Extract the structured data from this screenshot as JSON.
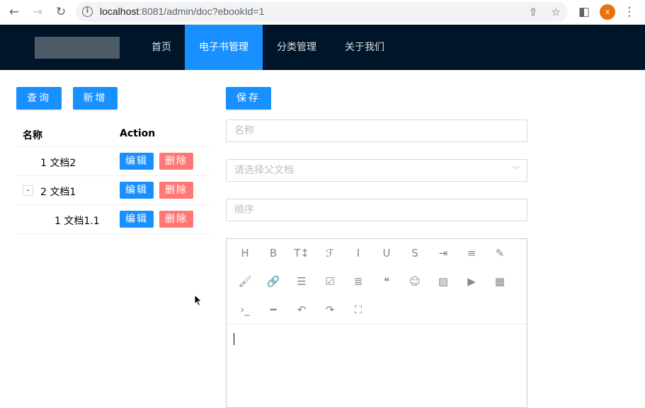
{
  "browser": {
    "url_host": "localhost",
    "url_rest": ":8081/admin/doc?ebookId=1",
    "profile_initial": "x"
  },
  "header": {
    "menu": [
      {
        "label": "首页",
        "active": false
      },
      {
        "label": "电子书管理",
        "active": true
      },
      {
        "label": "分类管理",
        "active": false
      },
      {
        "label": "关于我们",
        "active": false
      }
    ]
  },
  "left": {
    "query_label": "查询",
    "add_label": "新增",
    "columns": [
      "名称",
      "Action"
    ],
    "rows": [
      {
        "name": "1 文档2",
        "edit": "编辑",
        "delete": "删除"
      },
      {
        "expander": "-",
        "name": "2 文档1",
        "edit": "编辑",
        "delete": "删除"
      },
      {
        "name": "1 文档1.1",
        "edit": "编辑",
        "delete": "删除"
      }
    ]
  },
  "form": {
    "save_label": "保存",
    "name_placeholder": "名称",
    "parent_placeholder": "请选择父文档",
    "sort_placeholder": "顺序"
  },
  "editor": {
    "toolbar_icons": [
      {
        "name": "heading-icon",
        "glyph": "H"
      },
      {
        "name": "bold-icon",
        "glyph": "B"
      },
      {
        "name": "font-size-icon",
        "glyph": "T↕"
      },
      {
        "name": "font-family-icon",
        "glyph": "ℱ"
      },
      {
        "name": "italic-icon",
        "glyph": "I"
      },
      {
        "name": "underline-icon",
        "glyph": "U"
      },
      {
        "name": "strikethrough-icon",
        "glyph": "S"
      },
      {
        "name": "indent-icon",
        "glyph": "⇥"
      },
      {
        "name": "line-height-icon",
        "glyph": "≡"
      },
      {
        "name": "font-color-icon",
        "glyph": "✎"
      },
      {
        "name": "background-color-icon",
        "glyph": "🖌"
      },
      {
        "name": "link-icon",
        "glyph": "🔗"
      },
      {
        "name": "list-icon",
        "glyph": "☰"
      },
      {
        "name": "todo-icon",
        "glyph": "☑"
      },
      {
        "name": "align-icon",
        "glyph": "≣"
      },
      {
        "name": "quote-icon",
        "glyph": "❝"
      },
      {
        "name": "emoji-icon",
        "glyph": "☺"
      },
      {
        "name": "image-icon",
        "glyph": "▨"
      },
      {
        "name": "video-icon",
        "glyph": "▶"
      },
      {
        "name": "table-icon",
        "glyph": "▦"
      },
      {
        "name": "code-icon",
        "glyph": "›_"
      },
      {
        "name": "divider-icon",
        "glyph": "━"
      },
      {
        "name": "undo-icon",
        "glyph": "↶"
      },
      {
        "name": "redo-icon",
        "glyph": "↷"
      },
      {
        "name": "fullscreen-icon",
        "glyph": "⛶"
      }
    ]
  }
}
